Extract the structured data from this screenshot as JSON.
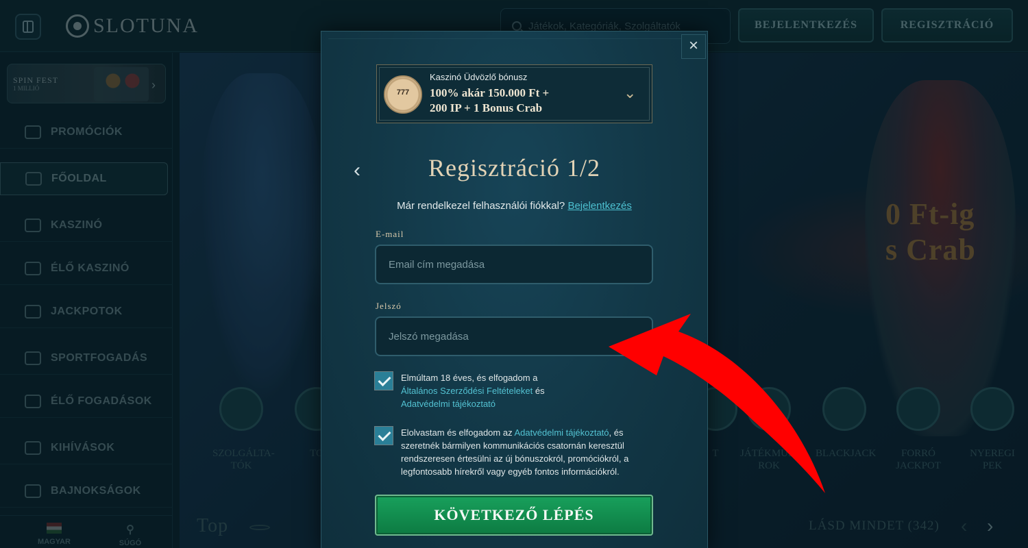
{
  "topbar": {
    "logo": "SLOTUNA",
    "search_placeholder": "Játékok, Kategóriák, Szolgáltatók",
    "login_label": "BEJELENTKEZÉS",
    "register_label": "REGISZTRÁCIÓ"
  },
  "sidebar": {
    "banner": {
      "title": "SPIN FEST",
      "subtitle": "1 MILLIÓ"
    },
    "items": [
      {
        "label": "PROMÓCIÓK",
        "icon": "promotions-icon"
      },
      {
        "label": "FŐOLDAL",
        "icon": "home-icon",
        "active": true
      },
      {
        "label": "KASZINÓ",
        "icon": "casino-icon"
      },
      {
        "label": "ÉLŐ KASZINÓ",
        "icon": "live-casino-icon"
      },
      {
        "label": "JACKPOTOK",
        "icon": "jackpot-icon"
      },
      {
        "label": "SPORTFOGADÁS",
        "icon": "sports-icon"
      },
      {
        "label": "ÉLŐ FOGADÁSOK",
        "icon": "live-bets-icon"
      },
      {
        "label": "KIHÍVÁSOK",
        "icon": "challenges-icon"
      },
      {
        "label": "BAJNOKSÁGOK",
        "icon": "tournaments-icon"
      }
    ],
    "language": "MAGYAR",
    "help": "SÚGÓ"
  },
  "hero": {
    "title_line1": "0 Ft-ig",
    "title_line2": "s Crab",
    "categories": [
      "SZOLGÁLTA-TÓK",
      "TO",
      "T",
      "JÁTÉKMŰSO-ROK",
      "BLACKJACK",
      "FORRÓ JACKPOT",
      "NYEREGI PEK"
    ],
    "top_label": "Top",
    "see_all": "LÁSD MINDET (342)"
  },
  "modal": {
    "bonus": {
      "label": "Kaszinó Üdvözlő bónusz",
      "amount_line1": "100% akár 150.000 Ft +",
      "amount_line2": "200 IP + 1 Bonus Crab"
    },
    "title": "Regisztráció 1/2",
    "already_text": "Már rendelkezel felhasználói fiókkal?",
    "login_link": "Bejelentkezés",
    "email": {
      "label": "E-mail",
      "placeholder": "Email cím megadása"
    },
    "password": {
      "label": "Jelszó",
      "placeholder": "Jelszó megadása"
    },
    "consent1": {
      "checked": true,
      "text1": "Elmúltam 18 éves, és elfogadom a",
      "link1": "Általános Szerződési Feltételeket",
      "text2": "és",
      "link2": "Adatvédelmi tájékoztató"
    },
    "consent2": {
      "checked": true,
      "text1": "Elolvastam és elfogadom az",
      "link1": "Adatvédelmi tájékoztató",
      "text2": ", és szeretnék bármilyen kommunikációs csatornán keresztül rendszeresen értesülni az új bónuszokról, promóciókról, a legfontosabb hírekről vagy egyéb fontos információkról."
    },
    "next_button": "KÖVETKEZŐ LÉPÉS"
  },
  "annotation": {
    "arrow_color": "#ff0000"
  }
}
